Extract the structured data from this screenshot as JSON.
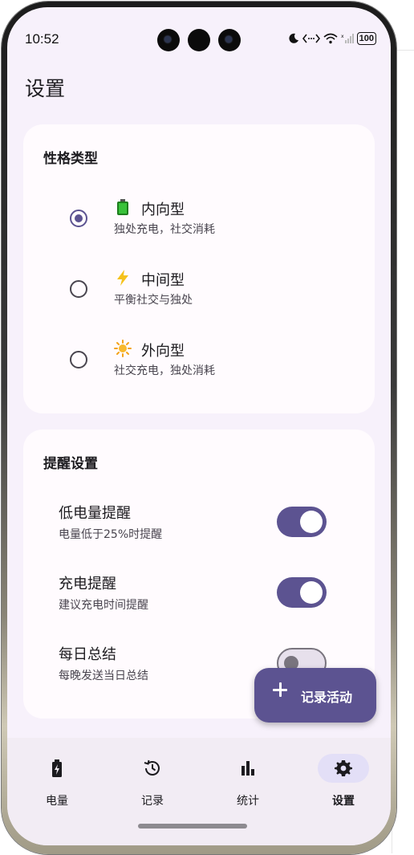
{
  "status_bar": {
    "time": "10:52",
    "battery": "100",
    "icons": [
      "moon-icon",
      "data-arrows-icon",
      "wifi-icon",
      "signal-icon",
      "battery-icon"
    ]
  },
  "app": {
    "title": "设置"
  },
  "personality": {
    "title": "性格类型",
    "options": [
      {
        "icon": "battery-icon",
        "label": "内向型",
        "desc": "独处充电，社交消耗",
        "selected": true
      },
      {
        "icon": "lightning-icon",
        "label": "中间型",
        "desc": "平衡社交与独处",
        "selected": false
      },
      {
        "icon": "sun-icon",
        "label": "外向型",
        "desc": "社交充电，独处消耗",
        "selected": false
      }
    ]
  },
  "reminders": {
    "title": "提醒设置",
    "items": [
      {
        "label": "低电量提醒",
        "desc": "电量低于25%时提醒",
        "enabled": true
      },
      {
        "label": "充电提醒",
        "desc": "建议充电时间提醒",
        "enabled": true
      },
      {
        "label": "每日总结",
        "desc": "每晚发送当日总结",
        "enabled": false
      }
    ]
  },
  "fab": {
    "label": "记录活动",
    "icon": "plus-icon"
  },
  "nav": {
    "items": [
      {
        "label": "电量",
        "icon": "battery-icon",
        "active": false
      },
      {
        "label": "记录",
        "icon": "history-icon",
        "active": false
      },
      {
        "label": "统计",
        "icon": "bar-chart-icon",
        "active": false
      },
      {
        "label": "设置",
        "icon": "gear-icon",
        "active": true
      }
    ]
  },
  "colors": {
    "primary": "#5c5391",
    "surface": "#f7f1fb",
    "card": "#fffbfe",
    "nav_indicator": "#e3dff7"
  }
}
